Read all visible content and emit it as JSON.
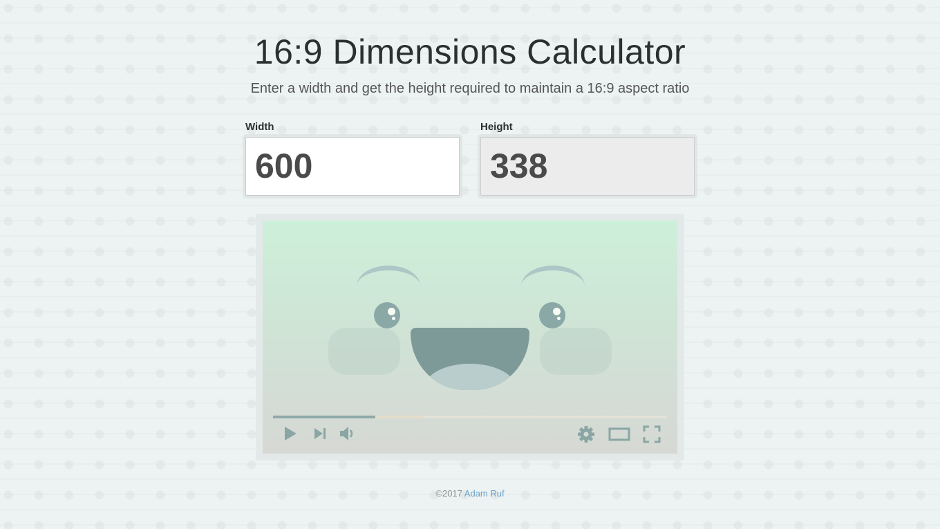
{
  "header": {
    "title": "16:9 Dimensions Calculator",
    "subtitle": "Enter a width and get the height required to maintain a 16:9 aspect ratio"
  },
  "form": {
    "width_label": "Width",
    "width_value": "600",
    "height_label": "Height",
    "height_value": "338"
  },
  "video_preview": {
    "progress_played": 0.26,
    "progress_buffered": 0.38,
    "controls": [
      "play-icon",
      "next-icon",
      "volume-icon",
      "settings-icon",
      "theater-icon",
      "fullscreen-icon"
    ],
    "colors": {
      "top": "#cdf0da",
      "bottom": "#d6d8d3",
      "accent": "#8fa9a8"
    }
  },
  "footer": {
    "copyright": "©2017",
    "author": "Adam Ruf"
  }
}
